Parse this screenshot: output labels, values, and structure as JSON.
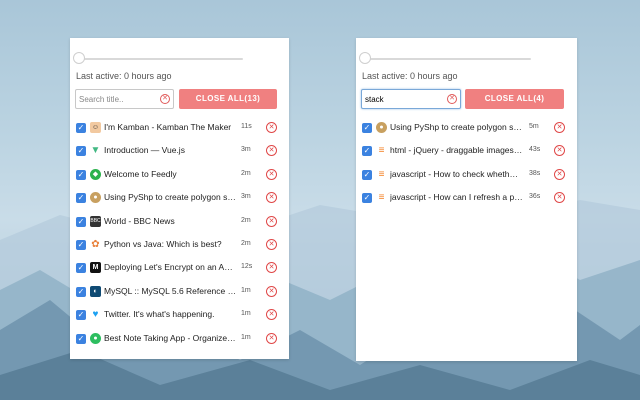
{
  "panels": [
    {
      "last_active": "Last active: 0 hours ago",
      "search": {
        "placeholder": "Search title..",
        "value": ""
      },
      "close_all_label": "CLOSE ALL(13)",
      "tabs": [
        {
          "title": "I'm Kamban - Kamban The Maker",
          "time": "11s",
          "icon": "avatar-face-icon",
          "color": "#f2c9a0"
        },
        {
          "title": "Introduction — Vue.js",
          "time": "3m",
          "icon": "vue-logo-icon",
          "color": "#42b883"
        },
        {
          "title": "Welcome to Feedly",
          "time": "2m",
          "icon": "feedly-logo-icon",
          "color": "#2bb24c"
        },
        {
          "title": "Using PyShp to create polygon s…",
          "time": "3m",
          "icon": "globe-icon",
          "color": "#c8a060"
        },
        {
          "title": "World - BBC News",
          "time": "2m",
          "icon": "bbc-logo-icon",
          "color": "#333333"
        },
        {
          "title": "Python vs Java: Which is best?",
          "time": "2m",
          "icon": "python-logo-icon",
          "color": "#e8803a"
        },
        {
          "title": "Deploying Let's Encrypt on an A…",
          "time": "12s",
          "icon": "medium-logo-icon",
          "color": "#111111"
        },
        {
          "title": "MySQL :: MySQL 5.6 Reference …",
          "time": "1m",
          "icon": "mysql-logo-icon",
          "color": "#0f4a73"
        },
        {
          "title": "Twitter. It's what's happening.",
          "time": "1m",
          "icon": "twitter-bird-icon",
          "color": "#1da1f2"
        },
        {
          "title": "Best Note Taking App - Organize…",
          "time": "1m",
          "icon": "evernote-logo-icon",
          "color": "#2dbe60"
        }
      ]
    },
    {
      "last_active": "Last active: 0 hours ago",
      "search": {
        "placeholder": "Search title..",
        "value": "stack"
      },
      "close_all_label": "CLOSE ALL(4)",
      "tabs": [
        {
          "title": "Using PyShp to create polygon s…",
          "time": "5m",
          "icon": "globe-icon",
          "color": "#c8a060"
        },
        {
          "title": "html - jQuery - draggable images…",
          "time": "43s",
          "icon": "stackoverflow-logo-icon",
          "color": "#f48024"
        },
        {
          "title": "javascript - How to check wheth…",
          "time": "38s",
          "icon": "stackoverflow-logo-icon",
          "color": "#f48024"
        },
        {
          "title": "javascript - How can I refresh a p…",
          "time": "36s",
          "icon": "stackoverflow-logo-icon",
          "color": "#f48024"
        }
      ]
    }
  ]
}
